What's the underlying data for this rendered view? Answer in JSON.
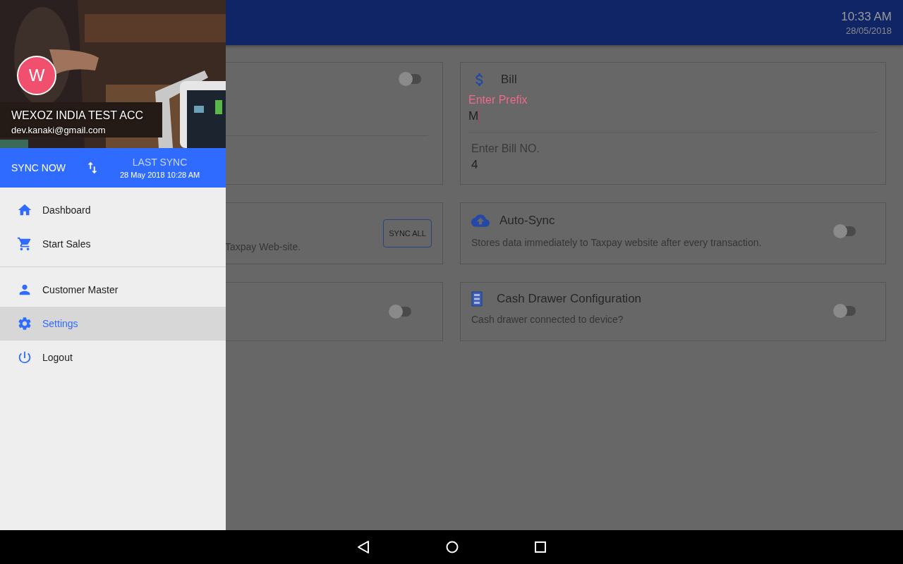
{
  "status": {
    "time": "10:33 AM",
    "date": "28/05/2018"
  },
  "drawer": {
    "avatar": "W",
    "name": "WEXOZ INDIA TEST ACC",
    "email": "dev.kanaki@gmail.com",
    "sync": {
      "button": "SYNC NOW",
      "last_label": "LAST SYNC",
      "last_time": "28 May 2018 10:28 AM"
    },
    "menu_groups": [
      {
        "items": [
          {
            "label": "Dashboard",
            "selected": false
          },
          {
            "label": "Start Sales",
            "selected": false
          }
        ]
      },
      {
        "items": [
          {
            "label": "Customer Master",
            "selected": false
          },
          {
            "label": "Settings",
            "selected": true
          },
          {
            "label": "Logout",
            "selected": false
          }
        ]
      }
    ]
  },
  "settings_left": [
    {
      "kind": "toggle",
      "on": false
    },
    {
      "kind": "sync",
      "description": "Taxpay Web-site.",
      "button": "SYNC ALL"
    },
    {
      "kind": "toggle",
      "on": false
    }
  ],
  "settings_right": [
    {
      "kind": "bill",
      "title": "Bill",
      "fields": [
        {
          "label": "Enter Prefix",
          "value": "M",
          "focused": true
        },
        {
          "label": "Enter Bill NO.",
          "value": "4",
          "focused": false
        }
      ]
    },
    {
      "kind": "toggle",
      "title": "Auto-Sync",
      "description": "Stores data immediately to Taxpay website after every transaction.",
      "on": false
    },
    {
      "kind": "toggle",
      "title": "Cash Drawer Configuration",
      "description": "Cash drawer connected to device?",
      "on": false
    }
  ]
}
